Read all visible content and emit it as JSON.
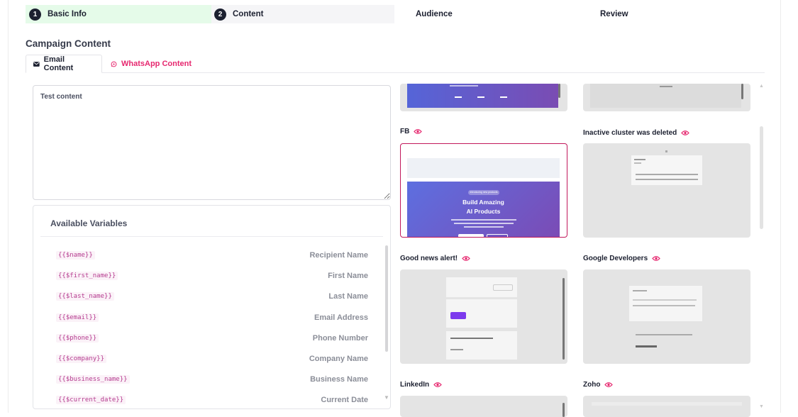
{
  "stepper": {
    "steps": [
      {
        "num": "1",
        "label": "Basic Info"
      },
      {
        "num": "2",
        "label": "Content"
      },
      {
        "num": "",
        "label": "Audience"
      },
      {
        "num": "",
        "label": "Review"
      }
    ]
  },
  "section_title": "Campaign Content",
  "tabs": {
    "email": {
      "label": "Email Content",
      "icon": "envelope-icon"
    },
    "whatsapp": {
      "label": "WhatsApp Content",
      "icon": "whatsapp-icon",
      "color": "#e6286f"
    }
  },
  "editor": {
    "value": "Test content"
  },
  "variables": {
    "title": "Available Variables",
    "items": [
      {
        "code": "{{$name}}",
        "label": "Recipient Name"
      },
      {
        "code": "{{$first_name}}",
        "label": "First Name"
      },
      {
        "code": "{{$last_name}}",
        "label": "Last Name"
      },
      {
        "code": "{{$email}}",
        "label": "Email Address"
      },
      {
        "code": "{{$phone}}",
        "label": "Phone Number"
      },
      {
        "code": "{{$company}}",
        "label": "Company Name"
      },
      {
        "code": "{{$business_name}}",
        "label": "Business Name"
      },
      {
        "code": "{{$current_date}}",
        "label": "Current Date"
      }
    ]
  },
  "templates": [
    {
      "name": "",
      "preview": "purple-stats"
    },
    {
      "name": "",
      "preview": "gray-footer"
    },
    {
      "name": "FB",
      "preview": "ai-products",
      "selected": true,
      "preview_text": {
        "pill": "Introducing new products",
        "headline_1": "Build Amazing",
        "headline_2": "AI Products"
      }
    },
    {
      "name": "Inactive cluster was deleted",
      "preview": "gray-card"
    },
    {
      "name": "Good news alert!",
      "preview": "gray-news"
    },
    {
      "name": "Google Developers",
      "preview": "gray-dev"
    },
    {
      "name": "LinkedIn",
      "preview": "gray-partial"
    },
    {
      "name": "Zoho",
      "preview": "gray-partial"
    }
  ],
  "colors": {
    "active_step_bg": "#e5fbe9",
    "accent_pink": "#e6286f",
    "selected_border": "#c2185b",
    "hero_gradient_start": "#5d6fe0",
    "hero_gradient_end": "#7b4bb5"
  }
}
